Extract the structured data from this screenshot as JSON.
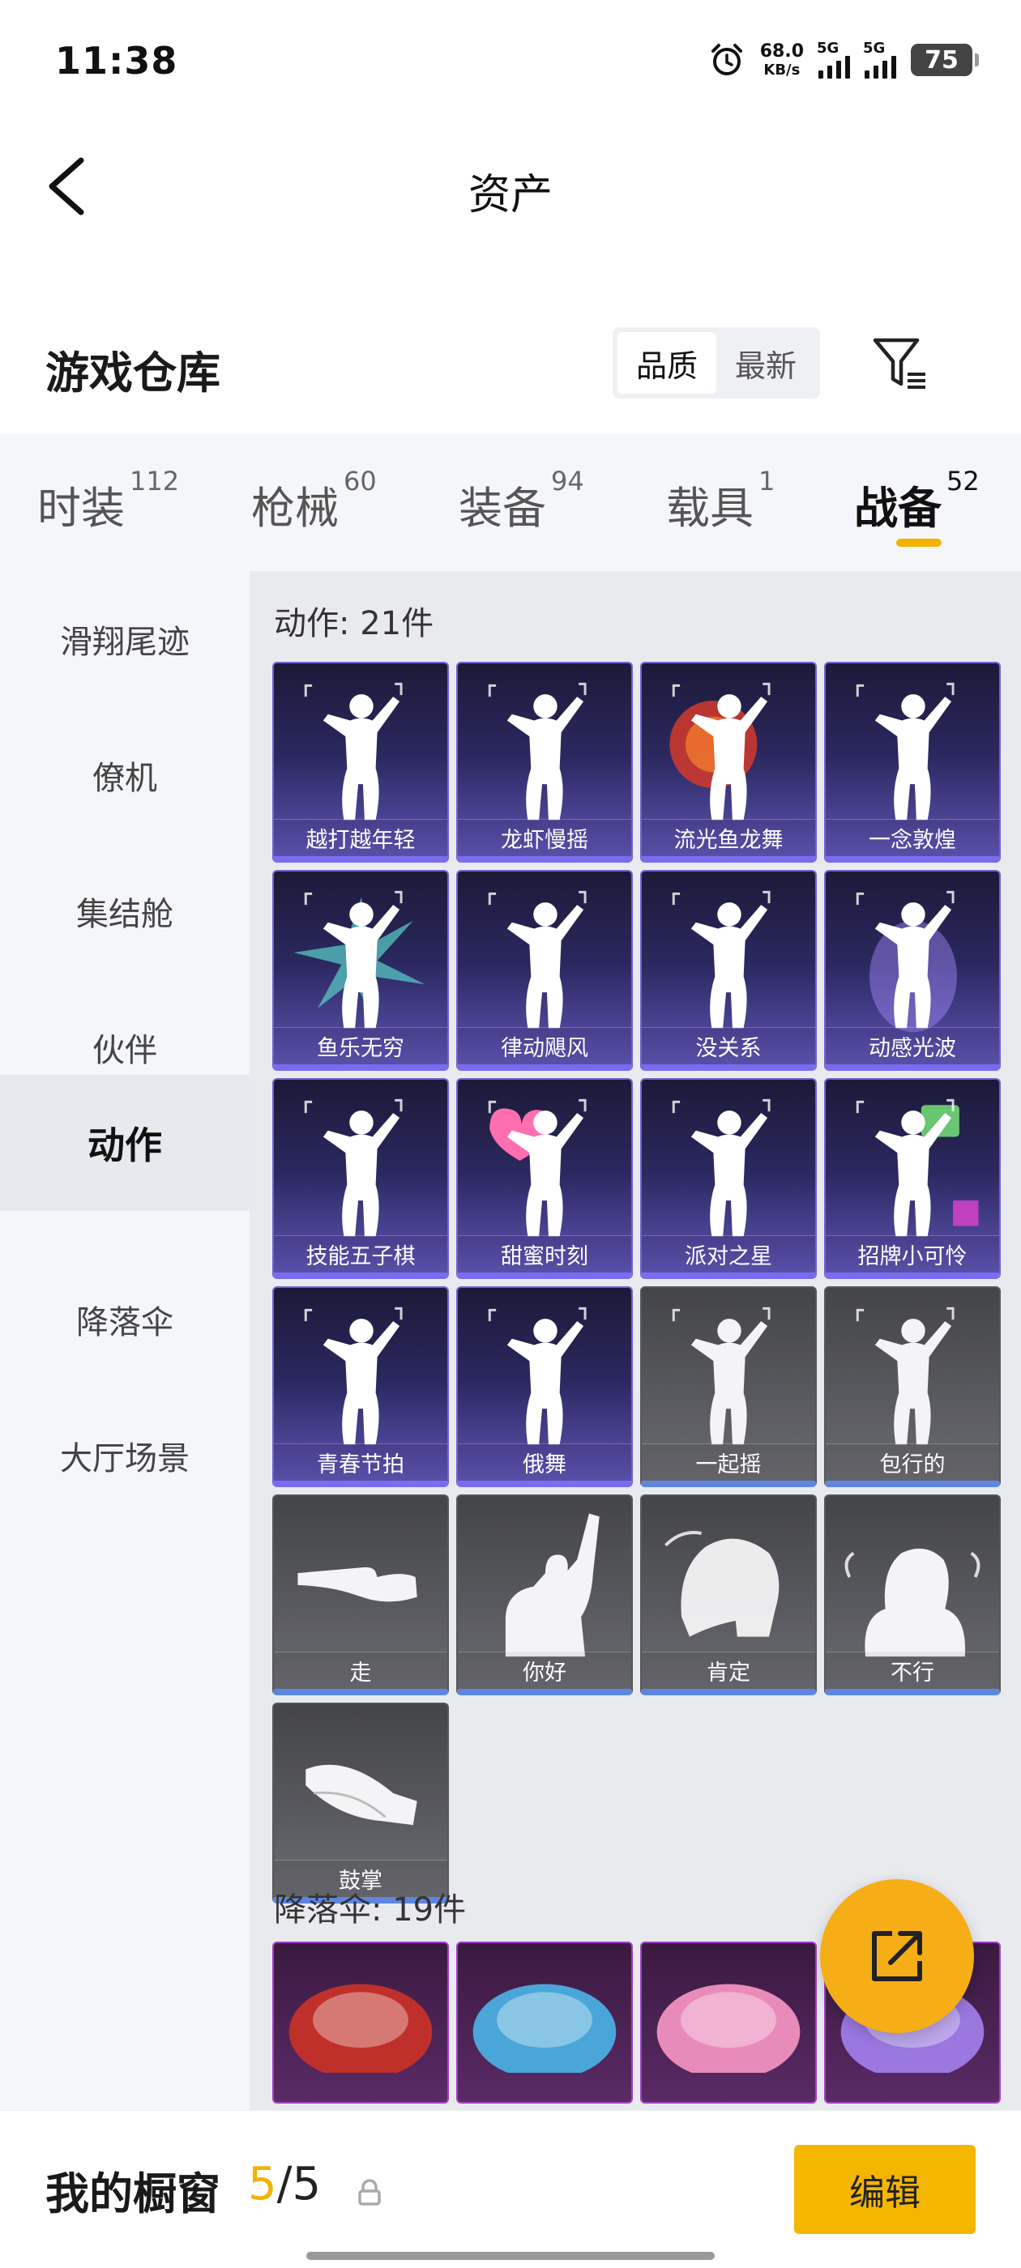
{
  "status_bar": {
    "time": "11:38",
    "net_speed_value": "68.0",
    "net_speed_unit": "KB/s",
    "sim1_label": "5G",
    "sim2_label": "5G",
    "battery": "75"
  },
  "header": {
    "title": "资产"
  },
  "warehouse": {
    "title": "游戏仓库",
    "sort_options": [
      "品质",
      "最新"
    ],
    "sort_selected": "品质"
  },
  "top_tabs": [
    {
      "label": "时装",
      "count": "112"
    },
    {
      "label": "枪械",
      "count": "60"
    },
    {
      "label": "装备",
      "count": "94"
    },
    {
      "label": "载具",
      "count": "1"
    },
    {
      "label": "战备",
      "count": "52"
    }
  ],
  "top_tab_active": "战备",
  "sidebar": {
    "items": [
      "滑翔尾迹",
      "僚机",
      "集结舱",
      "伙伴",
      "动作",
      "降落伞",
      "大厅场景"
    ],
    "active": "动作"
  },
  "sections": {
    "actions": {
      "title": "动作: 21件",
      "items": [
        {
          "name": "越打越年轻",
          "style": "purple",
          "icon": "dancer-figure-icon"
        },
        {
          "name": "龙虾慢摇",
          "style": "purple",
          "icon": "dancer-figure-icon"
        },
        {
          "name": "流光鱼龙舞",
          "style": "purple",
          "icon": "dancer-fan-icon"
        },
        {
          "name": "一念敦煌",
          "style": "purple",
          "icon": "dancer-figure-icon"
        },
        {
          "name": "鱼乐无穷",
          "style": "purple",
          "icon": "dancer-burst-icon"
        },
        {
          "name": "律动飓风",
          "style": "purple",
          "icon": "dancer-figure-icon"
        },
        {
          "name": "没关系",
          "style": "purple",
          "icon": "dancer-figure-icon"
        },
        {
          "name": "动感光波",
          "style": "purple",
          "icon": "dancer-glow-icon"
        },
        {
          "name": "技能五子棋",
          "style": "purple",
          "icon": "dancer-figure-icon"
        },
        {
          "name": "甜蜜时刻",
          "style": "purple",
          "icon": "dancer-heart-icon"
        },
        {
          "name": "派对之星",
          "style": "purple",
          "icon": "dancer-figure-icon"
        },
        {
          "name": "招牌小可怜",
          "style": "purple",
          "icon": "dancer-sign-icon"
        },
        {
          "name": "青春节拍",
          "style": "purple",
          "icon": "dancer-figure-icon"
        },
        {
          "name": "俄舞",
          "style": "purple",
          "icon": "dancer-figure-icon"
        },
        {
          "name": "一起摇",
          "style": "grey",
          "icon": "dancer-figure-icon"
        },
        {
          "name": "包行的",
          "style": "grey",
          "icon": "dancer-figure-icon"
        },
        {
          "name": "走",
          "style": "grey",
          "icon": "pointing-hand-icon"
        },
        {
          "name": "你好",
          "style": "grey",
          "icon": "waving-person-icon"
        },
        {
          "name": "肯定",
          "style": "grey",
          "icon": "nodding-head-icon"
        },
        {
          "name": "不行",
          "style": "grey",
          "icon": "shaking-head-icon"
        },
        {
          "name": "鼓掌",
          "style": "grey",
          "icon": "clapping-hands-icon"
        }
      ]
    },
    "parachutes": {
      "title": "降落伞: 19件",
      "items": [
        {
          "style": "chute",
          "icon": "parachute-red-icon",
          "color": "#c0302a"
        },
        {
          "style": "chute",
          "icon": "parachute-blue-icon",
          "color": "#4aa6d8"
        },
        {
          "style": "chute",
          "icon": "parachute-pink-icon",
          "color": "#e98bb8"
        },
        {
          "style": "chute",
          "icon": "parachute-purple-icon",
          "color": "#9a78e0"
        }
      ]
    }
  },
  "bottom_bar": {
    "label": "我的橱窗",
    "current": "5",
    "separator": "/",
    "total": "5",
    "edit_label": "编辑"
  },
  "colors": {
    "accent": "#f5b100",
    "purple_card": "#5e54b3",
    "grey_card": "#5a5b60"
  }
}
